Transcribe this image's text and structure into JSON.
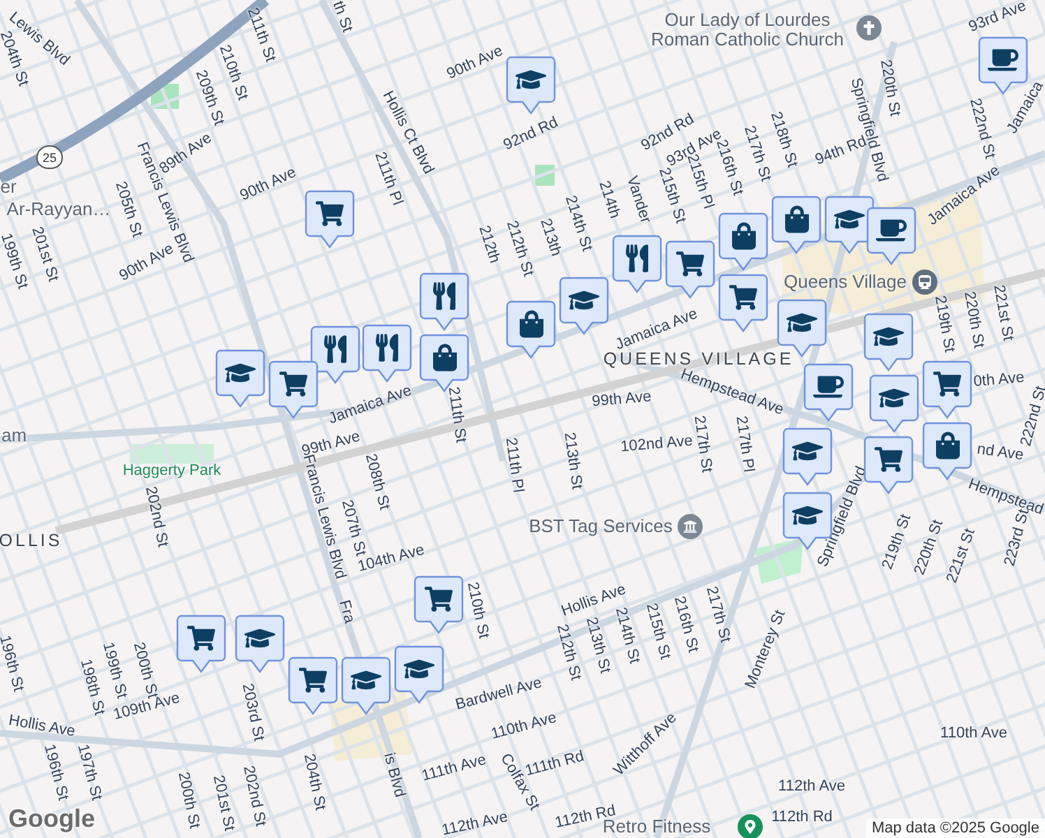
{
  "map": {
    "labels": [
      {
        "text": "Lewis Blvd",
        "kind": "street"
      },
      {
        "text": "204th St",
        "kind": "street"
      },
      {
        "text": "211th St",
        "kind": "street"
      },
      {
        "text": "210th St",
        "kind": "street"
      },
      {
        "text": "209th St",
        "kind": "street"
      },
      {
        "text": "th St",
        "kind": "street"
      },
      {
        "text": "90th Ave",
        "kind": "street"
      },
      {
        "text": "89th Ave",
        "kind": "street"
      },
      {
        "text": "Hollis Ct Blvd",
        "kind": "street"
      },
      {
        "text": "211th Pl",
        "kind": "street"
      },
      {
        "text": "90th Ave",
        "kind": "street"
      },
      {
        "text": "Francis Lewis Blvd",
        "kind": "street"
      },
      {
        "text": "205th St",
        "kind": "street"
      },
      {
        "text": "er",
        "kind": "place"
      },
      {
        "text": "Ar-Rayyan…",
        "kind": "place"
      },
      {
        "text": "201st St",
        "kind": "street"
      },
      {
        "text": "199th St",
        "kind": "street"
      },
      {
        "text": "90th Ave",
        "kind": "street"
      },
      {
        "text": "92nd Rd",
        "kind": "street"
      },
      {
        "text": "92nd Rd",
        "kind": "street"
      },
      {
        "text": "93rd Ave",
        "kind": "street"
      },
      {
        "text": "94th Rd",
        "kind": "street"
      },
      {
        "text": "93rd Ave",
        "kind": "street"
      },
      {
        "text": "218th St",
        "kind": "street"
      },
      {
        "text": "217th St",
        "kind": "street"
      },
      {
        "text": "216th St",
        "kind": "street"
      },
      {
        "text": "215th Pl",
        "kind": "street"
      },
      {
        "text": "215th St",
        "kind": "street"
      },
      {
        "text": "Vander",
        "kind": "street"
      },
      {
        "text": "214th",
        "kind": "street"
      },
      {
        "text": "214th St",
        "kind": "street"
      },
      {
        "text": "213th",
        "kind": "street"
      },
      {
        "text": "212th St",
        "kind": "street"
      },
      {
        "text": "212th",
        "kind": "street"
      },
      {
        "text": "Springfield Blvd",
        "kind": "street"
      },
      {
        "text": "220th St",
        "kind": "street"
      },
      {
        "text": "222nd St",
        "kind": "street"
      },
      {
        "text": "Jamaica",
        "kind": "street"
      },
      {
        "text": "Jamaica Ave",
        "kind": "street"
      },
      {
        "text": "Jamaica Ave",
        "kind": "street"
      },
      {
        "text": "Jamaica Ave",
        "kind": "street"
      },
      {
        "text": "QUEENS VILLAGE",
        "kind": "area"
      },
      {
        "text": "Hempstead Ave",
        "kind": "street"
      },
      {
        "text": "99th Ave",
        "kind": "street"
      },
      {
        "text": "219th St",
        "kind": "street"
      },
      {
        "text": "220th St",
        "kind": "street"
      },
      {
        "text": "221st St",
        "kind": "street"
      },
      {
        "text": "0th Ave",
        "kind": "street"
      },
      {
        "text": "nd Ave",
        "kind": "street"
      },
      {
        "text": "102nd Ave",
        "kind": "street"
      },
      {
        "text": "213th St",
        "kind": "street"
      },
      {
        "text": "217th St",
        "kind": "street"
      },
      {
        "text": "217th Pl",
        "kind": "street"
      },
      {
        "text": "211th St",
        "kind": "street"
      },
      {
        "text": "211th Pl",
        "kind": "street"
      },
      {
        "text": "Hempstead",
        "kind": "street"
      },
      {
        "text": "222nd St",
        "kind": "street"
      },
      {
        "text": "223rd St",
        "kind": "street"
      },
      {
        "text": "Springfield Blvd",
        "kind": "street"
      },
      {
        "text": "219th St",
        "kind": "street"
      },
      {
        "text": "220th St",
        "kind": "street"
      },
      {
        "text": "221st St",
        "kind": "street"
      },
      {
        "text": "Haggerty Park",
        "kind": "park"
      },
      {
        "text": "am",
        "kind": "place"
      },
      {
        "text": "OLLIS",
        "kind": "area"
      },
      {
        "text": "99th Ave",
        "kind": "street"
      },
      {
        "text": "202nd St",
        "kind": "street"
      },
      {
        "text": "Francis Lewis Blvd",
        "kind": "street"
      },
      {
        "text": "208th St",
        "kind": "street"
      },
      {
        "text": "207th St",
        "kind": "street"
      },
      {
        "text": "104th Ave",
        "kind": "street"
      },
      {
        "text": "210th St",
        "kind": "street"
      },
      {
        "text": "Hollis Ave",
        "kind": "street"
      },
      {
        "text": "212th St",
        "kind": "street"
      },
      {
        "text": "213th St",
        "kind": "street"
      },
      {
        "text": "214th St",
        "kind": "street"
      },
      {
        "text": "215th St",
        "kind": "street"
      },
      {
        "text": "216th St",
        "kind": "street"
      },
      {
        "text": "217th St",
        "kind": "street"
      },
      {
        "text": "Monterey St",
        "kind": "street"
      },
      {
        "text": "Bardwell Ave",
        "kind": "street"
      },
      {
        "text": "110th Ave",
        "kind": "street"
      },
      {
        "text": "110th Ave",
        "kind": "street"
      },
      {
        "text": "196th St",
        "kind": "street"
      },
      {
        "text": "199th St",
        "kind": "street"
      },
      {
        "text": "200th St",
        "kind": "street"
      },
      {
        "text": "198th St",
        "kind": "street"
      },
      {
        "text": "109th Ave",
        "kind": "street"
      },
      {
        "text": "203rd St",
        "kind": "street"
      },
      {
        "text": "Hollis Ave",
        "kind": "street"
      },
      {
        "text": "196th St",
        "kind": "street"
      },
      {
        "text": "197th St",
        "kind": "street"
      },
      {
        "text": "200th St",
        "kind": "street"
      },
      {
        "text": "201st St",
        "kind": "street"
      },
      {
        "text": "202nd St",
        "kind": "street"
      },
      {
        "text": "204th St",
        "kind": "street"
      },
      {
        "text": "Fra",
        "kind": "street"
      },
      {
        "text": "is Blvd",
        "kind": "street"
      },
      {
        "text": "111th Ave",
        "kind": "street"
      },
      {
        "text": "Colfax St",
        "kind": "street"
      },
      {
        "text": "111th Rd",
        "kind": "street"
      },
      {
        "text": "Witthoff Ave",
        "kind": "street"
      },
      {
        "text": "112th Ave",
        "kind": "street"
      },
      {
        "text": "112th Rd",
        "kind": "street"
      },
      {
        "text": "112th Ave",
        "kind": "street"
      },
      {
        "text": "112th Rd",
        "kind": "street"
      }
    ],
    "places": [
      {
        "name": "Our Lady of Lourdes Roman Catholic Church",
        "kind": "church"
      },
      {
        "name": "Queens Village",
        "kind": "station"
      },
      {
        "name": "BST Tag Services",
        "kind": "bank"
      },
      {
        "name": "Retro Fitness",
        "kind": "pin"
      }
    ],
    "pins": [
      {
        "kind": "cart"
      },
      {
        "kind": "fork"
      },
      {
        "kind": "fork"
      },
      {
        "kind": "school"
      },
      {
        "kind": "cart"
      },
      {
        "kind": "school"
      },
      {
        "kind": "fork"
      },
      {
        "kind": "bag"
      },
      {
        "kind": "bag"
      },
      {
        "kind": "school"
      },
      {
        "kind": "fork"
      },
      {
        "kind": "cart"
      },
      {
        "kind": "bag"
      },
      {
        "kind": "bag"
      },
      {
        "kind": "cart"
      },
      {
        "kind": "school"
      },
      {
        "kind": "cup"
      },
      {
        "kind": "cup"
      },
      {
        "kind": "school"
      },
      {
        "kind": "cup"
      },
      {
        "kind": "school"
      },
      {
        "kind": "school"
      },
      {
        "kind": "cart"
      },
      {
        "kind": "bag"
      },
      {
        "kind": "cart"
      },
      {
        "kind": "school"
      },
      {
        "kind": "school"
      },
      {
        "kind": "school"
      },
      {
        "kind": "cart"
      },
      {
        "kind": "school"
      },
      {
        "kind": "school"
      },
      {
        "kind": "cart"
      },
      {
        "kind": "cart"
      }
    ],
    "route_shield": "25",
    "logo": "Google",
    "attribution": "Map data ©2025 Google"
  }
}
